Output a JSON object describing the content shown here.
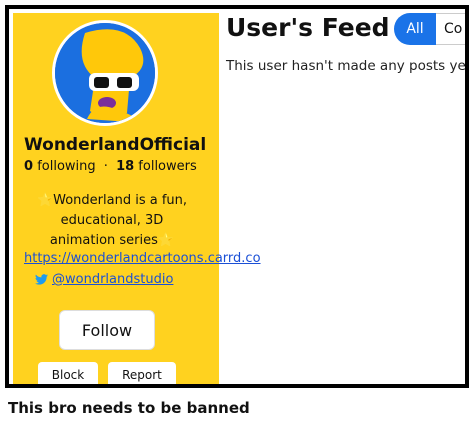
{
  "profile": {
    "username": "WonderlandOfficial",
    "following_count": "0",
    "following_label": "following",
    "separator": "·",
    "followers_count": "18",
    "followers_label": "followers",
    "bio_line1": "⭐Wonderland is a fun,",
    "bio_line2": "educational, 3D",
    "bio_line3": "animation series⭐",
    "website": "https://wonderlandcartoons.carrd.co",
    "twitter_handle": "@wondrlandstudio",
    "avatar_icon": "cartoon-character-avatar",
    "sidebar_color": "#FFD21F"
  },
  "actions": {
    "follow": "Follow",
    "block": "Block",
    "report": "Report"
  },
  "feed": {
    "title": "User's Feed",
    "tabs": [
      "All",
      "Co"
    ],
    "empty_message": "This user hasn't made any posts yet."
  },
  "caption": "This bro needs to be banned"
}
